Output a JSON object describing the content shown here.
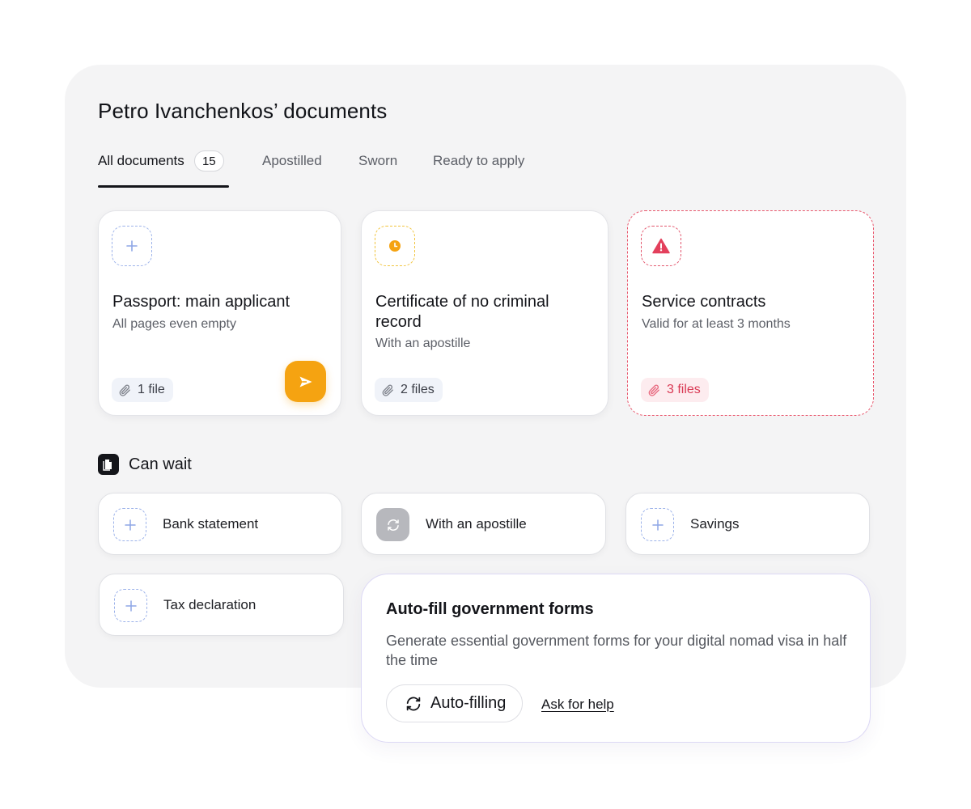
{
  "header": {
    "title": "Petro Ivanchenkos’ documents"
  },
  "tabs": [
    {
      "label": "All documents",
      "count": "15",
      "active": true
    },
    {
      "label": "Apostilled"
    },
    {
      "label": "Sworn"
    },
    {
      "label": "Ready to apply"
    }
  ],
  "documents": [
    {
      "title": "Passport: main applicant",
      "subtitle": "All pages even empty",
      "files": "1 file",
      "icon": "plus-icon",
      "status": "upload"
    },
    {
      "title": "Certificate of no criminal record",
      "subtitle": "With an apostille",
      "files": "2 files",
      "icon": "clock-icon",
      "status": "pending"
    },
    {
      "title": "Service contracts",
      "subtitle": "Valid for at least 3 months",
      "files": "3 files",
      "icon": "warning-icon",
      "status": "error"
    }
  ],
  "can_wait": {
    "title": "Can wait",
    "items": [
      {
        "label": "Bank statement",
        "icon": "plus-icon"
      },
      {
        "label": "With an apostille",
        "icon": "refresh-icon"
      },
      {
        "label": "Savings",
        "icon": "plus-icon"
      },
      {
        "label": "Tax declaration",
        "icon": "plus-icon"
      }
    ]
  },
  "promo": {
    "title": "Auto-fill government forms",
    "description": "Generate essential government forms for your digital nomad visa in half the time",
    "button_label": "Auto-filling",
    "link_label": "Ask for help"
  },
  "colors": {
    "accent_orange": "#f5a311",
    "warning_yellow": "#f1c43c",
    "error_red": "#e3566d",
    "dashed_blue": "#9db3ea",
    "panel_bg": "#f4f4f5"
  }
}
